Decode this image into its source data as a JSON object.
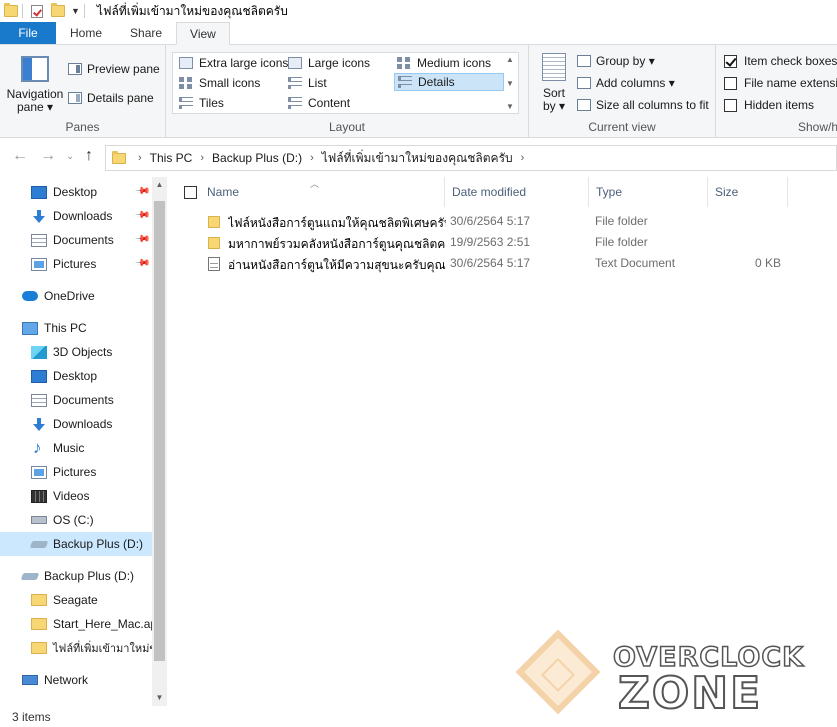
{
  "window": {
    "title": "ไฟล์ที่เพิ่มเข้ามาใหม่ของคุณชลิตครับ"
  },
  "ribbon_tabs": [
    {
      "label": "File"
    },
    {
      "label": "Home"
    },
    {
      "label": "Share"
    },
    {
      "label": "View"
    }
  ],
  "panes": {
    "navigation_pane": "Navigation pane ▾",
    "navigation_pane_l1": "Navigation",
    "navigation_pane_l2": "pane ▾",
    "preview_pane": "Preview pane",
    "details_pane": "Details pane",
    "group_label": "Panes"
  },
  "layout": {
    "items": [
      "Extra large icons",
      "Large icons",
      "Medium icons",
      "Small icons",
      "List",
      "Details",
      "Tiles",
      "Content"
    ],
    "selected": "Details",
    "group_label": "Layout"
  },
  "current_view": {
    "sort_by_l1": "Sort",
    "sort_by_l2": "by ▾",
    "group_by": "Group by ▾",
    "add_columns": "Add columns ▾",
    "size_all_columns": "Size all columns to fit",
    "group_label": "Current view"
  },
  "show_hide": {
    "item_check_boxes": "Item check boxes",
    "item_check_boxes_checked": true,
    "file_name_extensions": "File name extensions",
    "hidden_items": "Hidden items",
    "group_label": "Show/hide"
  },
  "address": {
    "crumbs": [
      "This PC",
      "Backup Plus (D:)",
      "ไฟล์ที่เพิ่มเข้ามาใหม่ของคุณชลิตครับ"
    ]
  },
  "nav_tree": [
    {
      "label": "Desktop",
      "icon": "desktop-icon",
      "pinned": true
    },
    {
      "label": "Downloads",
      "icon": "downloads-icon",
      "pinned": true
    },
    {
      "label": "Documents",
      "icon": "documents-icon",
      "pinned": true
    },
    {
      "label": "Pictures",
      "icon": "pictures-icon",
      "pinned": true
    },
    {
      "label": "OneDrive",
      "icon": "onedrive-icon"
    },
    {
      "label": "This PC",
      "icon": "this-pc-icon"
    },
    {
      "label": "3D Objects",
      "icon": "3d-objects-icon"
    },
    {
      "label": "Desktop",
      "icon": "desktop-icon"
    },
    {
      "label": "Documents",
      "icon": "documents-icon"
    },
    {
      "label": "Downloads",
      "icon": "downloads-icon"
    },
    {
      "label": "Music",
      "icon": "music-icon"
    },
    {
      "label": "Pictures",
      "icon": "pictures-icon"
    },
    {
      "label": "Videos",
      "icon": "videos-icon"
    },
    {
      "label": "OS (C:)",
      "icon": "os-drive-icon"
    },
    {
      "label": "Backup Plus (D:)",
      "icon": "external-drive-icon",
      "selected": true
    },
    {
      "label": "Backup Plus (D:)",
      "icon": "external-drive-icon"
    },
    {
      "label": "Seagate",
      "icon": "folder-icon"
    },
    {
      "label": "Start_Here_Mac.app",
      "icon": "folder-icon"
    },
    {
      "label": "ไฟล์ที่เพิ่มเข้ามาใหม่ของคุณชลิตครับ",
      "icon": "folder-icon"
    },
    {
      "label": "Network",
      "icon": "network-icon"
    }
  ],
  "columns": [
    "Name",
    "Date modified",
    "Type",
    "Size"
  ],
  "files": [
    {
      "name": "ไฟล์หนังสือการ์ตูนแถมให้คุณชลิตพิเศษครับ",
      "date": "30/6/2564 5:17",
      "type": "File folder",
      "size": "",
      "icon": "folder"
    },
    {
      "name": "มหากาพย์รวมคลังหนังสือการ์ตูนคุณชลิตครับ",
      "date": "19/9/2563 2:51",
      "type": "File folder",
      "size": "",
      "icon": "folder"
    },
    {
      "name": "อ่านหนังสือการ์ตูนให้มีความสุขนะครับคุณชลิต...",
      "date": "30/6/2564 5:17",
      "type": "Text Document",
      "size": "0 KB",
      "icon": "text"
    }
  ],
  "status": {
    "item_count": "3 items"
  },
  "watermark": {
    "line1": "OVERCLOCK",
    "line2": "ZONE"
  },
  "colors": {
    "file_tab": "#1979ca",
    "selection": "#cce8ff",
    "folder": "#f7d774"
  }
}
